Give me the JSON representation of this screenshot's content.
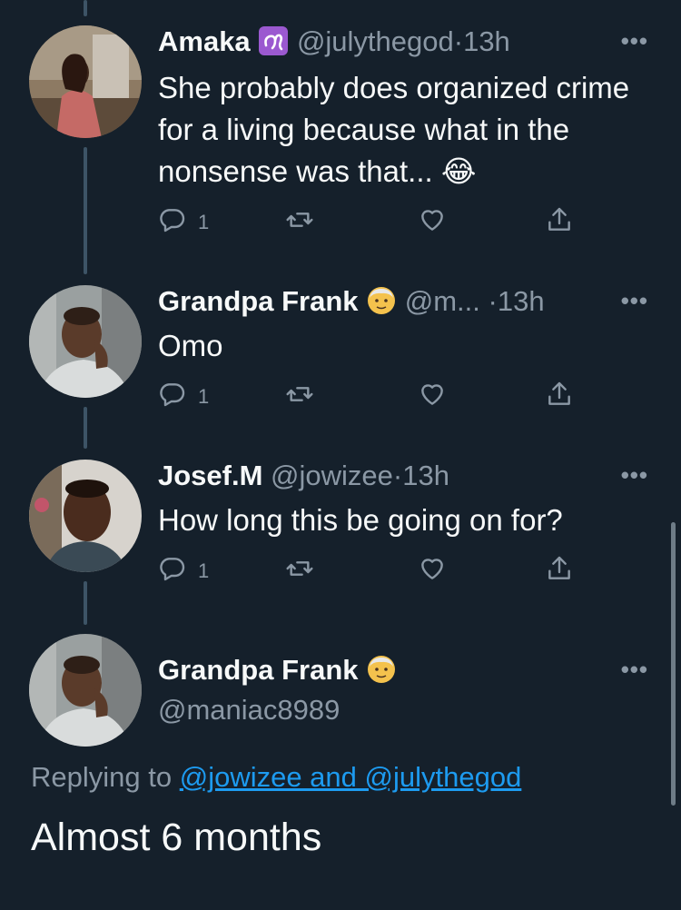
{
  "tweets": [
    {
      "name": "Amaka",
      "badge": "leo-zodiac-emoji",
      "handle": "@julythegod",
      "separator": "·",
      "time": "13h",
      "text": "She probably does organized crime for a living because what in the nonsense was that... 😂",
      "replies": "1"
    },
    {
      "name": "Grandpa Frank",
      "badge": "older-man-emoji",
      "handle": "@m...",
      "separator": "·",
      "time": "13h",
      "text": "Omo",
      "replies": "1"
    },
    {
      "name": "Josef.M",
      "handle": "@jowizee",
      "separator": "·",
      "time": "13h",
      "text": "How long this be going on for?",
      "replies": "1"
    }
  ],
  "focused": {
    "name": "Grandpa Frank",
    "badge": "older-man-emoji",
    "handle": "@maniac8989",
    "replying_prefix": "Replying to",
    "replying_to": "@jowizee and @julythegod",
    "text": "Almost 6 months"
  },
  "ui": {
    "more": "•••"
  },
  "colors": {
    "background": "#15202b",
    "secondary_text": "#8b98a5",
    "link": "#1d9bf0",
    "thread_line": "#3d5466"
  },
  "icons": [
    "reply-icon",
    "retweet-icon",
    "like-icon",
    "share-icon",
    "more-icon",
    "leo-zodiac-icon",
    "older-man-emoji-icon",
    "face-with-tears-of-joy-icon"
  ]
}
